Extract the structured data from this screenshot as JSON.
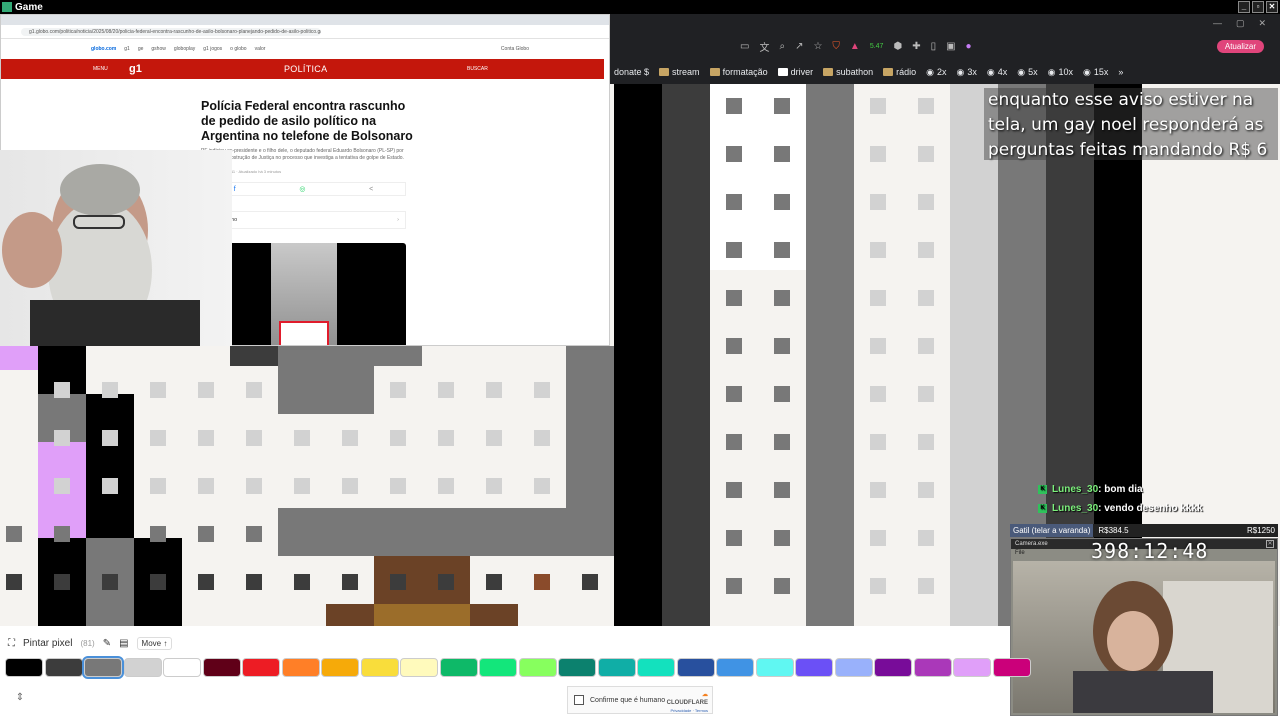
{
  "window": {
    "title": "Game",
    "controls": [
      "_",
      "▫",
      "✕"
    ]
  },
  "browser_left": {
    "url": "g1.globo.com/politica/noticia/2025/08/20/policia-federal-encontra-rascunho-de-asilo-bolsonaro-planejando-pedido-de-asilo-politico.ghtml",
    "globo_links": [
      "globo.com",
      "g1",
      "ge",
      "gshow",
      "globoplay",
      "g1 jogos",
      "o globo",
      "valor"
    ],
    "account": "Conta Globo",
    "menu_label": "MENU",
    "logo": "g1",
    "section": "POLÍTICA",
    "search_label": "BUSCAR",
    "headline": "Polícia Federal encontra rascunho de pedido de asilo político na Argentina no telefone de Bolsonaro",
    "subtitle": "PF indiciou ex-presidente e o filho dele, o deputado federal Eduardo Bolsonaro (PL-SP) por tentativa de obstrução de Justiça no processo que investiga a tentativa de golpe de Estado.",
    "meta": "20/08/2025 | 19h11 · Atualizado há 3 minutos",
    "summary": "Ver resumo"
  },
  "right_toolbar": {
    "update_label": "Atualizar",
    "badge": "5.47",
    "bookmarks": [
      "donate $",
      "stream",
      "formatação",
      "driver",
      "subathon",
      "rádio",
      "2x",
      "3x",
      "4x",
      "5x",
      "10x",
      "15x"
    ]
  },
  "notice_text": "enquanto esse aviso estiver na tela, um gay noel responderá as perguntas feitas mandando R$ 6",
  "chat": [
    {
      "user": "Lunes_30",
      "text": ": bom dia"
    },
    {
      "user": "Lunes_30",
      "text": ": vendo desenho kkkk"
    }
  ],
  "goal": {
    "label": "Gatil (telar a varanda)",
    "current": "R$384.5",
    "target": "R$1250",
    "progress": 0.31
  },
  "webcam_right": {
    "window_title": "Camera.exe",
    "menu": "File",
    "timer": "398:12:48"
  },
  "bottom": {
    "tool_label": "Pintar pixel",
    "count": "(81)",
    "move_label": "Move ↑",
    "selected_color_index": 2,
    "palette": [
      "#000000",
      "#3c3c3c",
      "#787878",
      "#d2d2d2",
      "#ffffff",
      "#600018",
      "#ed1c24",
      "#ff7f27",
      "#f6aa09",
      "#f9dd3b",
      "#fffabc",
      "#0eb968",
      "#13e67b",
      "#87ff5e",
      "#0c816e",
      "#10aea6",
      "#13e1be",
      "#28509e",
      "#4093e4",
      "#60f7f2",
      "#6b50f6",
      "#99b1fb",
      "#780c99",
      "#aa38b9",
      "#e09ff9",
      "#cb007a"
    ],
    "captcha_label": "Confirme que é humano",
    "captcha_brand": "CLOUDFLARE",
    "captcha_links": "Privacidade · Termos"
  }
}
